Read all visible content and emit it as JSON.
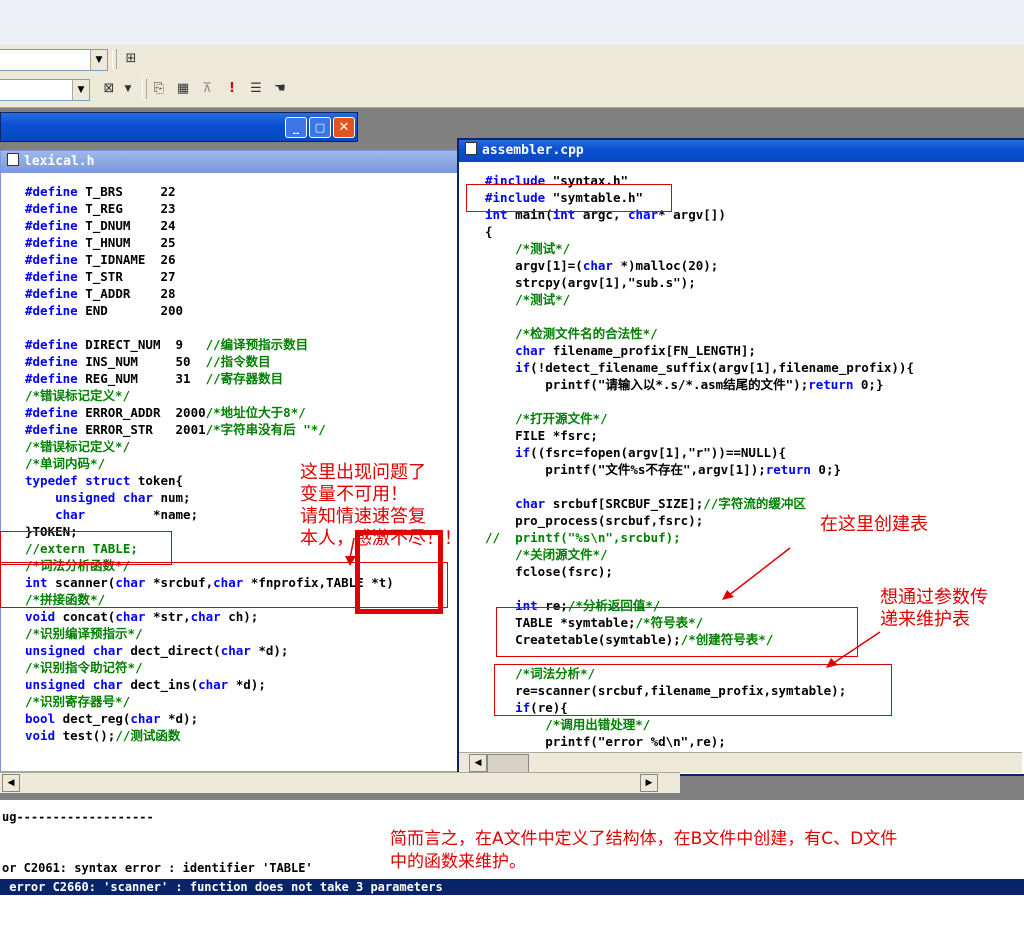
{
  "toolbar": {
    "icons": [
      "binoculars-icon",
      "wand-icon",
      "compile-icon",
      "build-icon",
      "stop-icon",
      "execute-icon",
      "debug-list-icon",
      "hand-icon"
    ],
    "execute_glyph": "!"
  },
  "lexical": {
    "title": "lexical.h",
    "lines": [
      [
        [
          "kw",
          "#define"
        ],
        [
          "t",
          " T_BRS     22"
        ]
      ],
      [
        [
          "kw",
          "#define"
        ],
        [
          "t",
          " T_REG     23"
        ]
      ],
      [
        [
          "kw",
          "#define"
        ],
        [
          "t",
          " T_DNUM    24"
        ]
      ],
      [
        [
          "kw",
          "#define"
        ],
        [
          "t",
          " T_HNUM    25"
        ]
      ],
      [
        [
          "kw",
          "#define"
        ],
        [
          "t",
          " T_IDNAME  26"
        ]
      ],
      [
        [
          "kw",
          "#define"
        ],
        [
          "t",
          " T_STR     27"
        ]
      ],
      [
        [
          "kw",
          "#define"
        ],
        [
          "t",
          " T_ADDR    28"
        ]
      ],
      [
        [
          "kw",
          "#define"
        ],
        [
          "t",
          " END       200"
        ]
      ],
      [
        [
          "t",
          ""
        ]
      ],
      [
        [
          "kw",
          "#define"
        ],
        [
          "t",
          " DIRECT_NUM  9   "
        ],
        [
          "cm",
          "//编译预指示数目"
        ]
      ],
      [
        [
          "kw",
          "#define"
        ],
        [
          "t",
          " INS_NUM     50  "
        ],
        [
          "cm",
          "//指令数目"
        ]
      ],
      [
        [
          "kw",
          "#define"
        ],
        [
          "t",
          " REG_NUM     31  "
        ],
        [
          "cm",
          "//寄存器数目"
        ]
      ],
      [
        [
          "cm",
          "/*错误标记定义*/"
        ]
      ],
      [
        [
          "kw",
          "#define"
        ],
        [
          "t",
          " ERROR_ADDR  2000"
        ],
        [
          "cm",
          "/*地址位大于8*/"
        ]
      ],
      [
        [
          "kw",
          "#define"
        ],
        [
          "t",
          " ERROR_STR   2001"
        ],
        [
          "cm",
          "/*字符串没有后 \"*/"
        ]
      ],
      [
        [
          "cm",
          "/*错误标记定义*/"
        ]
      ],
      [
        [
          "cm",
          "/*单词内码*/"
        ]
      ],
      [
        [
          "kw",
          "typedef struct"
        ],
        [
          "t",
          " token{"
        ]
      ],
      [
        [
          "t",
          "    "
        ],
        [
          "kw",
          "unsigned char"
        ],
        [
          "t",
          " num;"
        ]
      ],
      [
        [
          "t",
          "    "
        ],
        [
          "kw",
          "char"
        ],
        [
          "t",
          "         *name;"
        ]
      ],
      [
        [
          "t",
          "}TOKEN;"
        ]
      ],
      [
        [
          "cm",
          "//extern TABLE;"
        ]
      ],
      [
        [
          "cm",
          "/*词法分析函数*/"
        ]
      ],
      [
        [
          "kw",
          "int"
        ],
        [
          "t",
          " scanner("
        ],
        [
          "kw",
          "char"
        ],
        [
          "t",
          " *srcbuf,"
        ],
        [
          "kw",
          "char"
        ],
        [
          "t",
          " *fnprofix,TABLE *t)"
        ]
      ],
      [
        [
          "cm",
          "/*拼接函数*/"
        ]
      ],
      [
        [
          "kw",
          "void"
        ],
        [
          "t",
          " concat("
        ],
        [
          "kw",
          "char"
        ],
        [
          "t",
          " *str,"
        ],
        [
          "kw",
          "char"
        ],
        [
          "t",
          " ch);"
        ]
      ],
      [
        [
          "cm",
          "/*识别编译预指示*/"
        ]
      ],
      [
        [
          "kw",
          "unsigned char"
        ],
        [
          "t",
          " dect_direct("
        ],
        [
          "kw",
          "char"
        ],
        [
          "t",
          " *d);"
        ]
      ],
      [
        [
          "cm",
          "/*识别指令助记符*/"
        ]
      ],
      [
        [
          "kw",
          "unsigned char"
        ],
        [
          "t",
          " dect_ins("
        ],
        [
          "kw",
          "char"
        ],
        [
          "t",
          " *d);"
        ]
      ],
      [
        [
          "cm",
          "/*识别寄存器号*/"
        ]
      ],
      [
        [
          "kw",
          "bool"
        ],
        [
          "t",
          " dect_reg("
        ],
        [
          "kw",
          "char"
        ],
        [
          "t",
          " *d);"
        ]
      ],
      [
        [
          "kw",
          "void"
        ],
        [
          "t",
          " test();"
        ],
        [
          "cm",
          "//测试函数"
        ]
      ]
    ]
  },
  "assembler": {
    "title": "assembler.cpp",
    "lines": [
      [
        [
          "kw",
          "#include"
        ],
        [
          "t",
          " \"syntax.h\""
        ]
      ],
      [
        [
          "kw",
          "#include"
        ],
        [
          "t",
          " \"symtable.h\""
        ]
      ],
      [
        [
          "kw",
          "int"
        ],
        [
          "t",
          " main("
        ],
        [
          "kw",
          "int"
        ],
        [
          "t",
          " argc, "
        ],
        [
          "kw",
          "char"
        ],
        [
          "t",
          "* argv[])"
        ]
      ],
      [
        [
          "t",
          "{"
        ]
      ],
      [
        [
          "t",
          "    "
        ],
        [
          "cm",
          "/*测试*/"
        ]
      ],
      [
        [
          "t",
          "    argv[1]=("
        ],
        [
          "kw",
          "char"
        ],
        [
          "t",
          " *)malloc(20);"
        ]
      ],
      [
        [
          "t",
          "    strcpy(argv[1],\"sub.s\");"
        ]
      ],
      [
        [
          "t",
          "    "
        ],
        [
          "cm",
          "/*测试*/"
        ]
      ],
      [
        [
          "t",
          ""
        ]
      ],
      [
        [
          "t",
          "    "
        ],
        [
          "cm",
          "/*检测文件名的合法性*/"
        ]
      ],
      [
        [
          "t",
          "    "
        ],
        [
          "kw",
          "char"
        ],
        [
          "t",
          " filename_profix[FN_LENGTH];"
        ]
      ],
      [
        [
          "t",
          "    "
        ],
        [
          "kw",
          "if"
        ],
        [
          "t",
          "(!detect_filename_suffix(argv[1],filename_profix)){"
        ]
      ],
      [
        [
          "t",
          "        printf(\"请输入以*.s/*.asm结尾的文件\");"
        ],
        [
          "kw",
          "return"
        ],
        [
          "t",
          " 0;}"
        ]
      ],
      [
        [
          "t",
          ""
        ]
      ],
      [
        [
          "t",
          "    "
        ],
        [
          "cm",
          "/*打开源文件*/"
        ]
      ],
      [
        [
          "t",
          "    FILE *fsrc;"
        ]
      ],
      [
        [
          "t",
          "    "
        ],
        [
          "kw",
          "if"
        ],
        [
          "t",
          "((fsrc=fopen(argv[1],\"r\"))==NULL){"
        ]
      ],
      [
        [
          "t",
          "        printf(\"文件%s不存在\",argv[1]);"
        ],
        [
          "kw",
          "return"
        ],
        [
          "t",
          " 0;}"
        ]
      ],
      [
        [
          "t",
          ""
        ]
      ],
      [
        [
          "t",
          "    "
        ],
        [
          "kw",
          "char"
        ],
        [
          "t",
          " srcbuf[SRCBUF_SIZE];"
        ],
        [
          "cm",
          "//字符流的缓冲区"
        ]
      ],
      [
        [
          "t",
          "    pro_process(srcbuf,fsrc);"
        ]
      ],
      [
        [
          "cm",
          "//  printf(\"%s\\n\",srcbuf);"
        ]
      ],
      [
        [
          "t",
          "    "
        ],
        [
          "cm",
          "/*关闭源文件*/"
        ]
      ],
      [
        [
          "t",
          "    fclose(fsrc);"
        ]
      ],
      [
        [
          "t",
          ""
        ]
      ],
      [
        [
          "t",
          "    "
        ],
        [
          "kw",
          "int"
        ],
        [
          "t",
          " re;"
        ],
        [
          "cm",
          "/*分析返回值*/"
        ]
      ],
      [
        [
          "t",
          "    TABLE *symtable;"
        ],
        [
          "cm",
          "/*符号表*/"
        ]
      ],
      [
        [
          "t",
          "    Createtable(symtable);"
        ],
        [
          "cm",
          "/*创建符号表*/"
        ]
      ],
      [
        [
          "t",
          ""
        ]
      ],
      [
        [
          "t",
          "    "
        ],
        [
          "cm",
          "/*词法分析*/"
        ]
      ],
      [
        [
          "t",
          "    re=scanner(srcbuf,filename_profix,symtable);"
        ]
      ],
      [
        [
          "t",
          "    "
        ],
        [
          "kw",
          "if"
        ],
        [
          "t",
          "(re){"
        ]
      ],
      [
        [
          "t",
          "        "
        ],
        [
          "cm",
          "/*调用出错处理*/"
        ]
      ],
      [
        [
          "t",
          "        printf(\"error %d\\n\",re);"
        ]
      ]
    ]
  },
  "annotations": {
    "problem": "这里出现问题了\n变量不可用！\n请知情速速答复\n本人，感激不尽！！",
    "create_table": "在这里创建表",
    "maintain": "想通过参数传\n递来维护表",
    "summary": "简而言之，在A文件中定义了结构体，在B文件中创建，有C、D文件\n中的函数来维护。"
  },
  "output": {
    "line1": "ug-------------------",
    "line2": "or C2061: syntax error : identifier 'TABLE'",
    "line3": " error C2660: 'scanner' : function does not take 3 parameters"
  },
  "colors": {
    "annotation": "#e00000",
    "keyword": "#0000ff",
    "comment": "#008000",
    "titlebar_active": "#0a52d2",
    "highlight": "#0a246a"
  }
}
